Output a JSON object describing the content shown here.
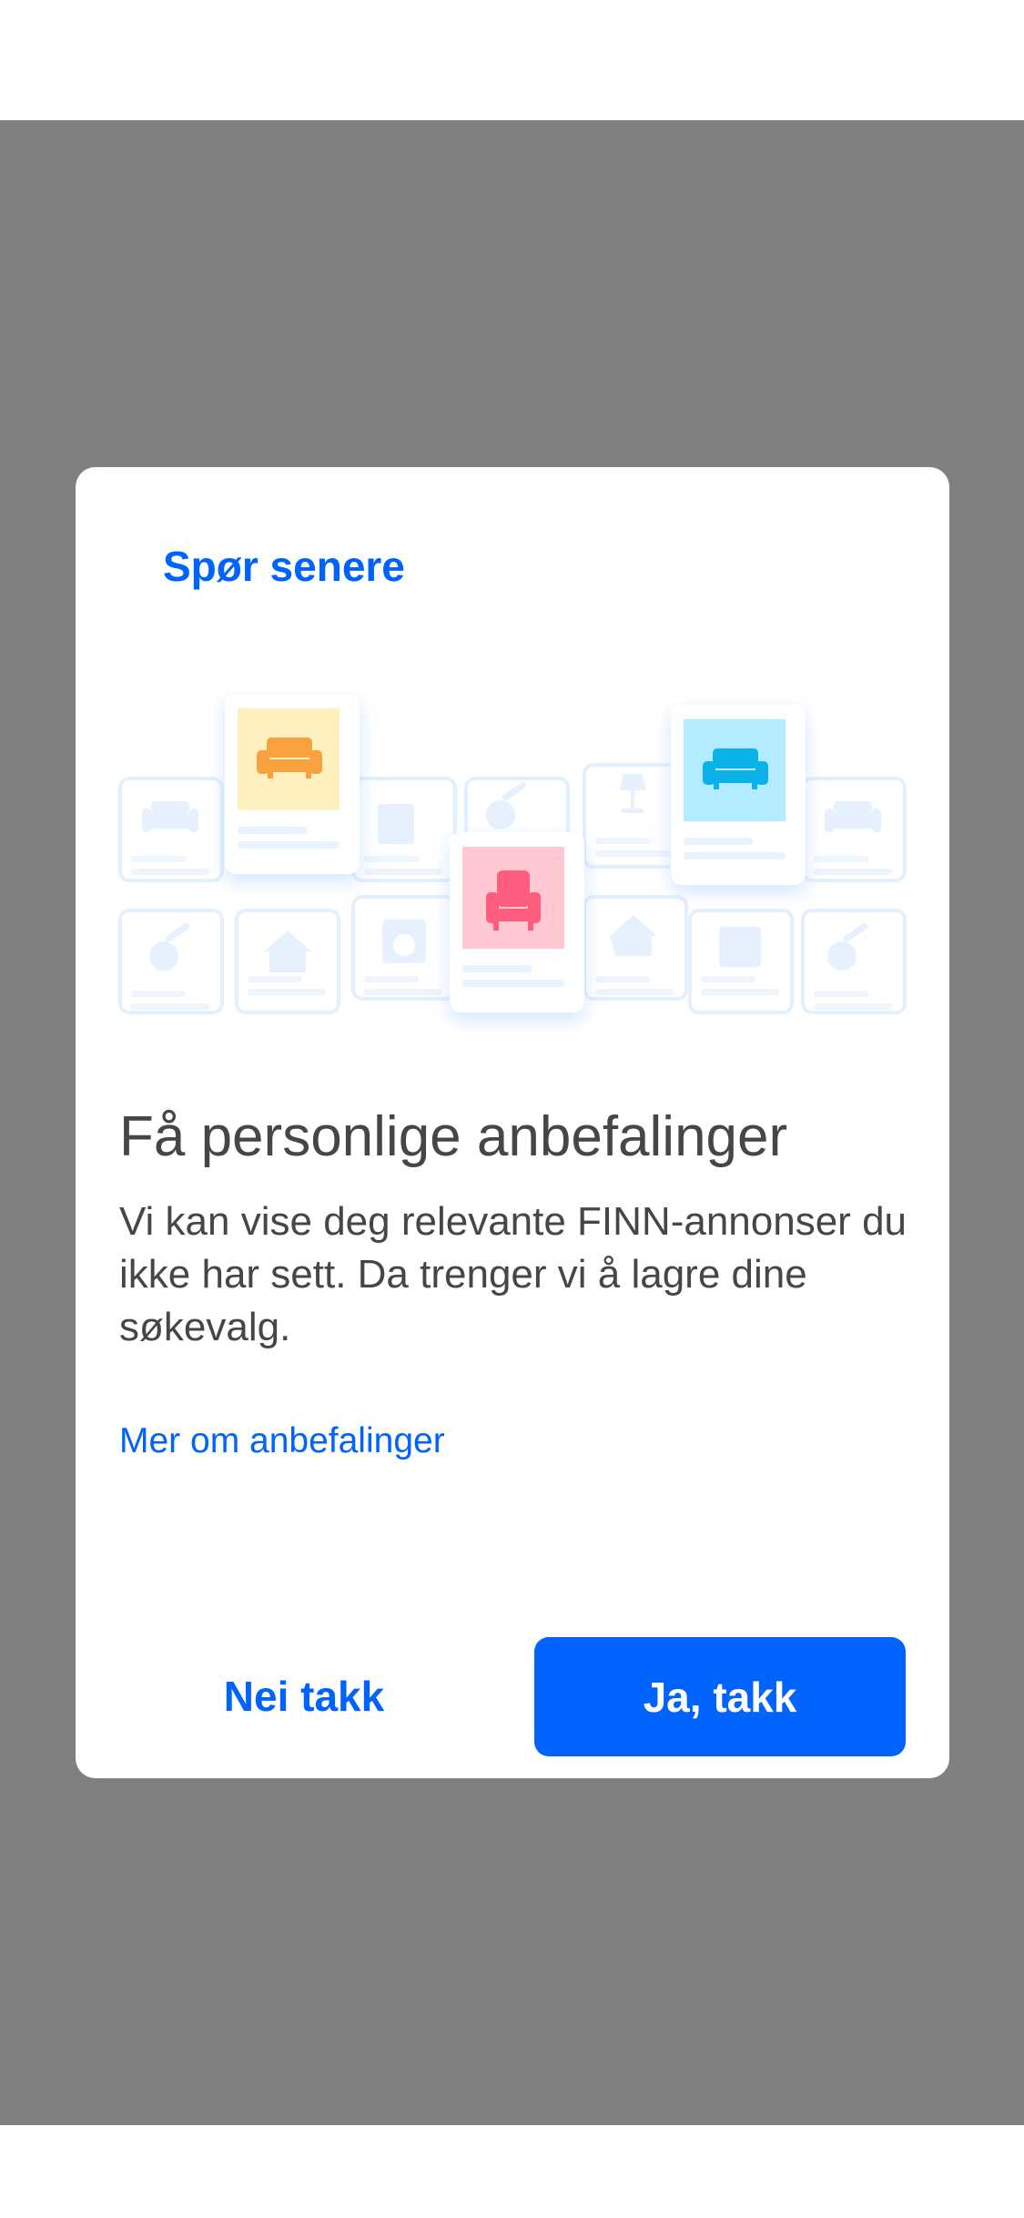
{
  "dialog": {
    "ask_later_label": "Spør senere",
    "title": "Få personlige anbefalinger",
    "body": "Vi kan vise deg relevante FINN-annonser du ikke har sett. Da trenger vi å lagre dine søkevalg.",
    "more_link_label": "Mer om anbefalinger",
    "decline_label": "Nei takk",
    "accept_label": "Ja, takk"
  },
  "illustration": {
    "featured_cards": [
      {
        "item": "sofa-icon",
        "color": "#f9a03f",
        "background": "#fff0bf"
      },
      {
        "item": "armchair-icon",
        "color": "#ff5d7f",
        "background": "#ffc8d3"
      },
      {
        "item": "sofa-icon",
        "color": "#0ab2e7",
        "background": "#b3ecff"
      }
    ],
    "background_items": [
      "sofa-icon",
      "guitar-icon",
      "house-icon",
      "washing-machine-icon",
      "dresser-icon",
      "lamp-icon",
      "guitar-icon",
      "house-icon",
      "dresser-icon",
      "sofa-icon",
      "guitar-icon"
    ]
  },
  "colors": {
    "accent": "#0063fb",
    "scrim": "#808080",
    "text": "#464646"
  }
}
